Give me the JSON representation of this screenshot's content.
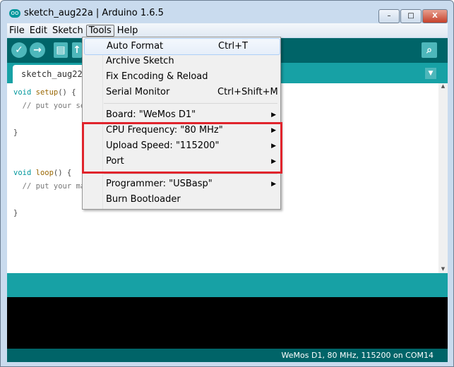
{
  "window": {
    "title": "sketch_aug22a | Arduino 1.6.5",
    "minimize": "–",
    "maximize": "□",
    "close": "X"
  },
  "menubar": [
    "File",
    "Edit",
    "Sketch",
    "Tools",
    "Help"
  ],
  "toolbar": {
    "verify": "✓",
    "upload": "→",
    "new": "▤",
    "open": "↑",
    "serial_monitor": "⌕"
  },
  "tab": {
    "label": "sketch_aug22a",
    "menu_arrow": "▼"
  },
  "code": {
    "line1_kw": "void",
    "line1_fn": "setup",
    "line1_rest": "() {",
    "line2": "  // put your se",
    "line3": "}",
    "line4_kw": "void",
    "line4_fn": "loop",
    "line4_rest": "() {",
    "line5": "  // put your ma",
    "line6": "}"
  },
  "tools_menu": {
    "items": [
      {
        "label": "Auto Format",
        "shortcut": "Ctrl+T"
      },
      {
        "label": "Archive Sketch"
      },
      {
        "label": "Fix Encoding & Reload"
      },
      {
        "label": "Serial Monitor",
        "shortcut": "Ctrl+Shift+M"
      },
      {
        "label": "Board: \"WeMos D1\"",
        "arrow": "▶"
      },
      {
        "label": "CPU Frequency: \"80 MHz\"",
        "arrow": "▶"
      },
      {
        "label": "Upload Speed: \"115200\"",
        "arrow": "▶"
      },
      {
        "label": "Port",
        "arrow": "▶"
      },
      {
        "label": "Programmer: \"USBasp\"",
        "arrow": "▶"
      },
      {
        "label": "Burn Bootloader"
      }
    ]
  },
  "status": {
    "text": "WeMos D1, 80 MHz, 115200 on COM14"
  },
  "colors": {
    "toolbar": "#006468",
    "teal": "#17a1a5",
    "highlight_box": "#e0242c"
  }
}
